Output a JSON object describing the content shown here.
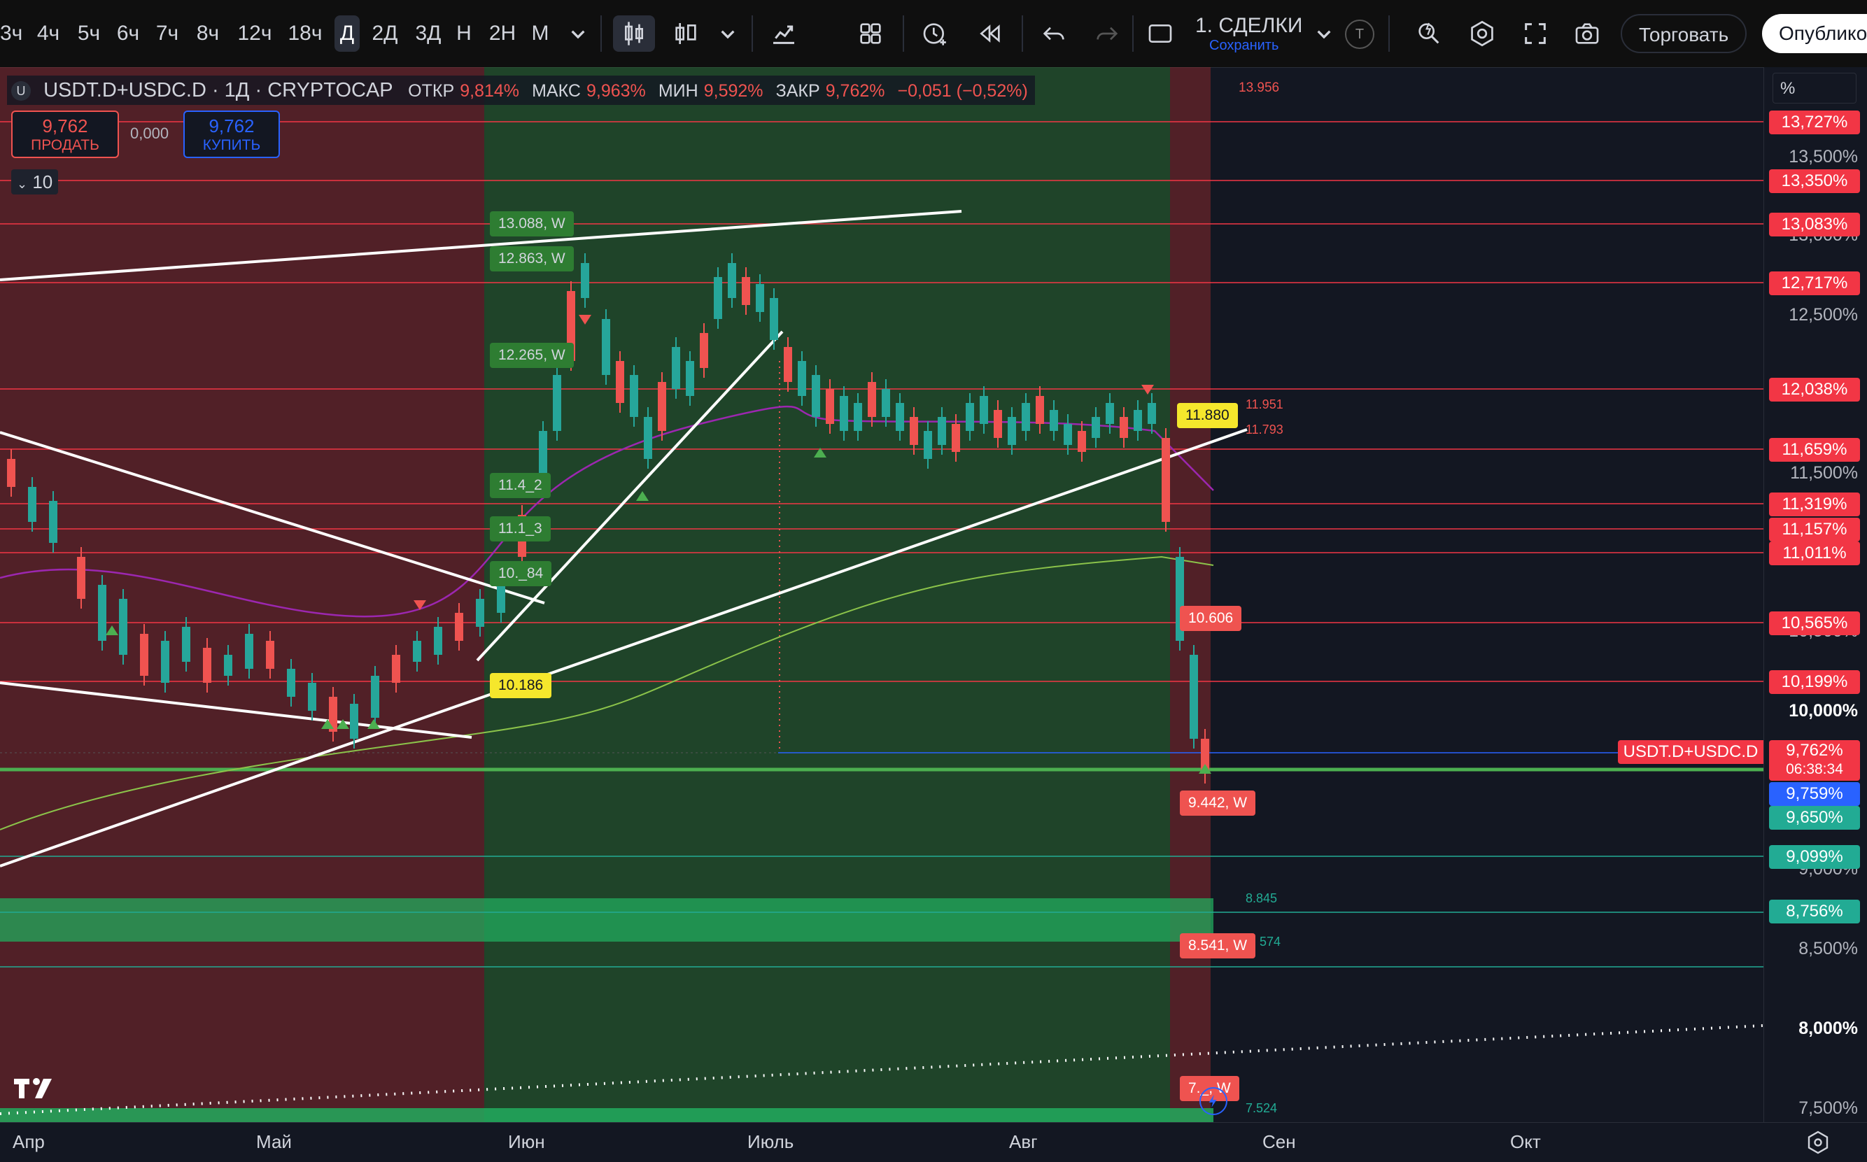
{
  "toolbar": {
    "timeframes": [
      "3ч",
      "4ч",
      "5ч",
      "6ч",
      "7ч",
      "8ч",
      "12ч",
      "18ч",
      "Д",
      "2Д",
      "3Д",
      "Н",
      "2Н",
      "М"
    ],
    "active_timeframe": "Д",
    "layout_name": "1. СДЕЛКИ",
    "layout_save": "Сохранить",
    "t_badge": "T",
    "trade_button": "Торговать",
    "publish_button": "Опубликовать"
  },
  "legend": {
    "symbol_badge": "U",
    "title": "USDT.D+USDC.D · 1Д · CRYPTOCAP",
    "open_label": "ОТКР",
    "open_value": "9,814%",
    "high_label": "МАКС",
    "high_value": "9,963%",
    "low_label": "МИН",
    "low_value": "9,592%",
    "close_label": "ЗАКР",
    "close_value": "9,762%",
    "change": "−0,051 (−0,52%)"
  },
  "trade": {
    "sell_price": "9,762",
    "sell_label": "ПРОДАТЬ",
    "spread": "0,000",
    "buy_price": "9,762",
    "buy_label": "КУПИТЬ",
    "indicators_count": "10"
  },
  "price_scale": {
    "unit_label": "%",
    "ticks": [
      "13,500%",
      "13,000%",
      "12,500%",
      "11,500%",
      "10,500%",
      "10,000%",
      "9,000%",
      "8,500%",
      "8,000%",
      "7,500%"
    ],
    "level_tags": [
      "13,727%",
      "13,350%",
      "13,083%",
      "12,717%",
      "12,038%",
      "11,659%",
      "11,319%",
      "11,157%",
      "11,011%",
      "10,565%",
      "10,199%",
      "9,099%",
      "8,756%"
    ],
    "current_price": "9,762%",
    "countdown": "06:38:34",
    "blue_tag": "9,759%",
    "green_tag": "9,650%",
    "symbol_tag": "USDT.D+USDC.D"
  },
  "chart_labels": {
    "top_value": "13.956",
    "left_w": [
      "13.088, W",
      "12.863, W",
      "12.265, W",
      "11.4_2",
      "11.1_3",
      "10._84"
    ],
    "yellow_left": "10.186",
    "yellow_right": "11.880",
    "right_small": [
      "11.951",
      "11.793"
    ],
    "red_w": [
      "10.606",
      "9.442, W",
      "8.541, W",
      "7._, W"
    ],
    "green_small": [
      "8.845",
      "574",
      "7.524"
    ]
  },
  "time_axis": {
    "labels": [
      "Апр",
      "Май",
      "Июн",
      "Июль",
      "Авг",
      "Сен",
      "Окт"
    ]
  },
  "colors": {
    "bg": "#131722",
    "up": "#26a69a",
    "down": "#ef5350",
    "level_line": "#f23645",
    "green_zone": "#22ab94",
    "yellow": "#f5e72c"
  }
}
